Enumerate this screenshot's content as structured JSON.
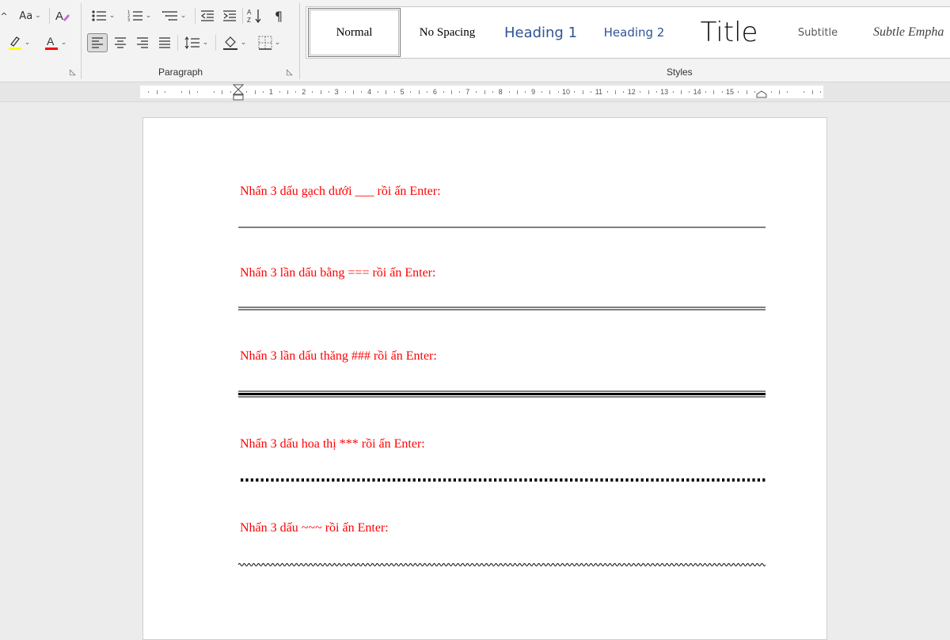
{
  "ribbon": {
    "font_group": {
      "change_case_label": "Aa",
      "highlight_color": "#ffff00",
      "font_color": "#ff0000"
    },
    "paragraph_group": {
      "label": "Paragraph",
      "show_marks_symbol": "¶",
      "sort_label": "A Z"
    },
    "styles_group": {
      "label": "Styles",
      "items": [
        {
          "name": "Normal"
        },
        {
          "name": "No Spacing"
        },
        {
          "name": "Heading 1"
        },
        {
          "name": "Heading 2"
        },
        {
          "name": "Title"
        },
        {
          "name": "Subtitle"
        },
        {
          "name": "Subtle Empha"
        }
      ]
    }
  },
  "ruler": {
    "numbers": [
      "1",
      "2",
      "3",
      "4",
      "5",
      "6",
      "7",
      "8",
      "9",
      "10",
      "11",
      "12",
      "13",
      "14",
      "15"
    ]
  },
  "document": {
    "text_color": "#ff0000",
    "paragraphs": [
      {
        "text": "Nhấn 3 dấu gạch dưới ___ rồi ấn Enter:"
      },
      {
        "text": "Nhấn 3 lần dấu bằng === rồi ấn Enter:"
      },
      {
        "text": "Nhấn 3 lần dấu thăng ### rồi ấn Enter:"
      },
      {
        "text": "Nhấn 3 dấu hoa thị *** rồi ấn Enter:"
      },
      {
        "text": "Nhấn 3 dấu ~~~ rồi ấn Enter:"
      }
    ]
  }
}
